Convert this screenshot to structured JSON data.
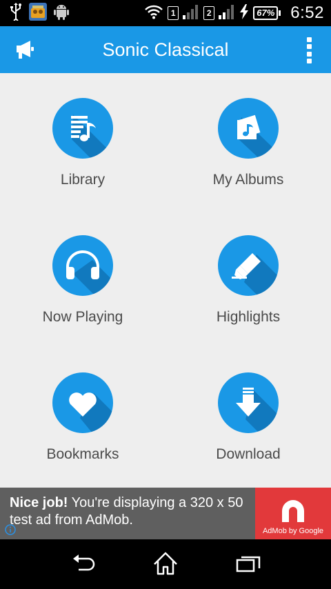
{
  "status_bar": {
    "left_icons": [
      "usb-icon",
      "notification-app-icon",
      "android-icon"
    ],
    "right_icons": [
      "wifi-icon",
      "sim1-icon",
      "signal1-icon",
      "sim2-icon",
      "signal2-icon",
      "charging-icon",
      "battery-icon"
    ],
    "sim1_label": "1",
    "sim2_label": "2",
    "battery": "67%",
    "time": "6:52"
  },
  "app_bar": {
    "title": "Sonic Classical",
    "left_icon": "megaphone-icon",
    "right_icon": "overflow-menu-icon",
    "color": "#1a98e6"
  },
  "menu": {
    "items": [
      {
        "label": "Library",
        "icon": "library-music-icon"
      },
      {
        "label": "My Albums",
        "icon": "albums-icon"
      },
      {
        "label": "Now Playing",
        "icon": "headphones-icon"
      },
      {
        "label": "Highlights",
        "icon": "highlighter-icon"
      },
      {
        "label": "Bookmarks",
        "icon": "heart-icon"
      },
      {
        "label": "Download",
        "icon": "download-icon"
      }
    ]
  },
  "ad": {
    "headline": "Nice job!",
    "body": " You're displaying a 320 x 50 test ad from AdMob.",
    "brand": "AdMob by Google",
    "info_icon": "info-icon"
  },
  "nav_bar": {
    "buttons": [
      "back-icon",
      "home-icon",
      "recent-apps-icon"
    ]
  },
  "colors": {
    "accent": "#1a98e6",
    "background": "#eeeeee",
    "label": "#4a4a4a",
    "ad_bg": "#5f5f5f",
    "admob_red": "#e2393b"
  }
}
